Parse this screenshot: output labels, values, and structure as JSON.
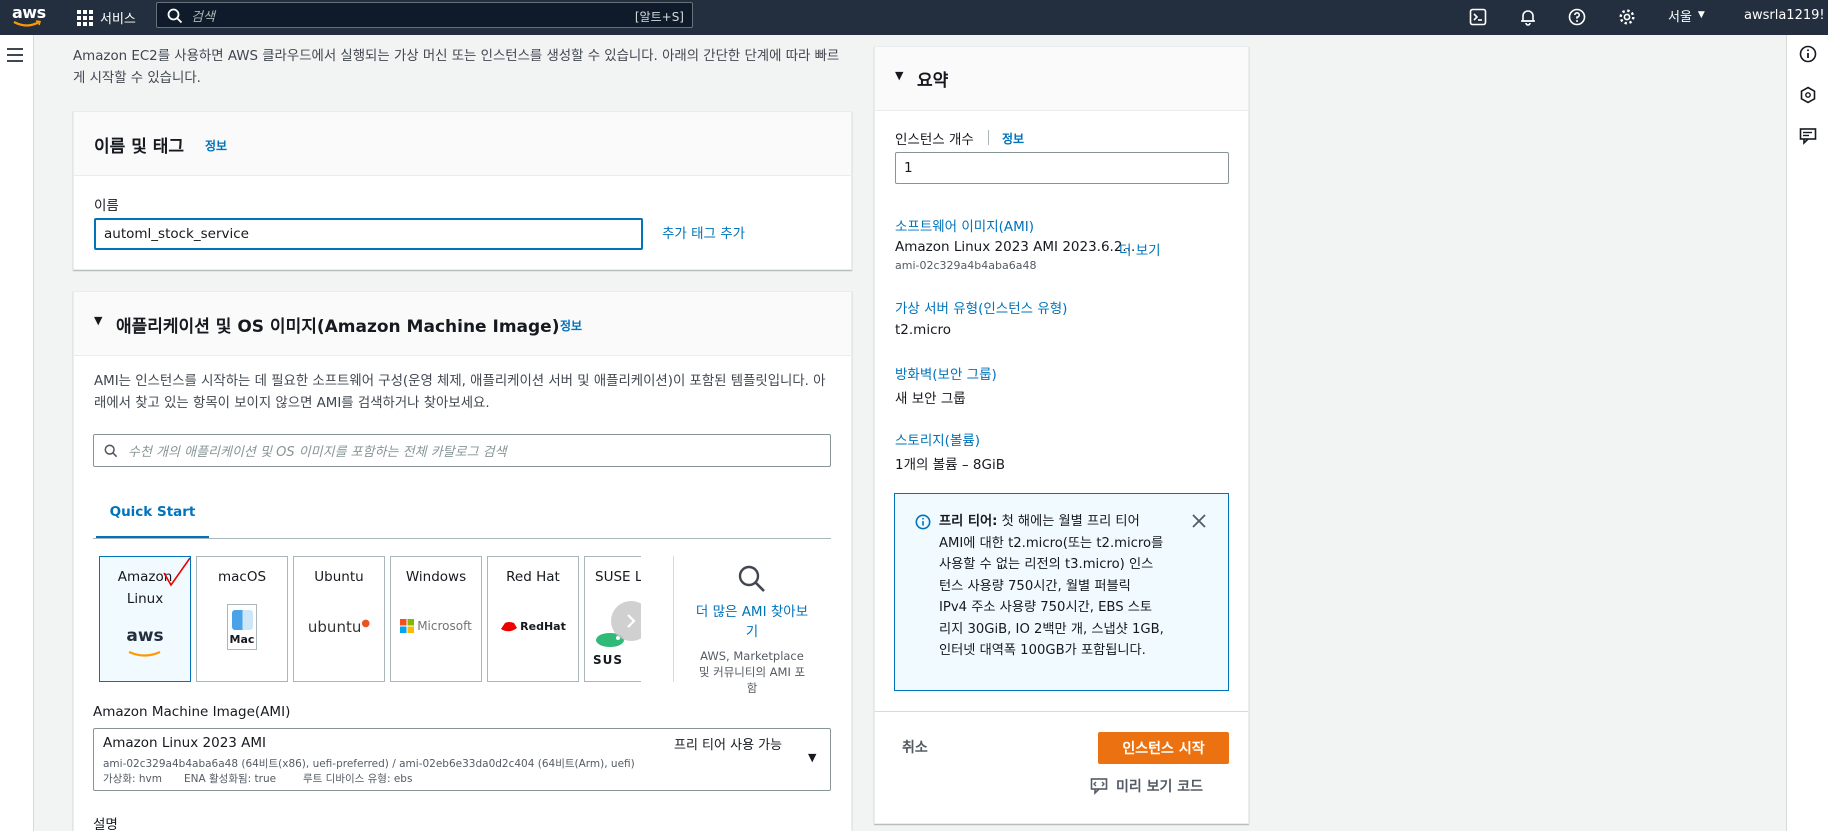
{
  "topnav": {
    "logo_text": "aws",
    "services_label": "서비스",
    "search_placeholder": "검색",
    "search_shortcut": "[알트+S]",
    "region": "서울",
    "user": "awsrla1219!"
  },
  "intro_text": "Amazon EC2를 사용하면 AWS 클라우드에서 실행되는 가상 머신 또는 인스턴스를 생성할 수 있습니다. 아래의 간단한 단계에 따라 빠르게 시작할 수 있습니다.",
  "name_tags": {
    "title": "이름 및 태그",
    "info": "정보",
    "name_label": "이름",
    "name_value": "automl_stock_service",
    "add_tag": "추가 태그 추가"
  },
  "ami_section": {
    "title": "애플리케이션 및 OS 이미지(Amazon Machine Image)",
    "info": "정보",
    "description": "AMI는 인스턴스를 시작하는 데 필요한 소프트웨어 구성(운영 체제, 애플리케이션 서버 및 애플리케이션)이 포함된 템플릿입니다. 아래에서 찾고 있는 항목이 보이지 않으면 AMI를 검색하거나 찾아보세요.",
    "search_placeholder": "수천 개의 애플리케이션 및 OS 이미지를 포함하는 전체 카탈로그 검색",
    "tab": "Quick Start",
    "tiles": [
      {
        "name": "Amazon Linux",
        "logo": "aws"
      },
      {
        "name": "macOS",
        "logo": "Mac"
      },
      {
        "name": "Ubuntu",
        "logo": "ubuntu"
      },
      {
        "name": "Windows",
        "logo": "Microsoft"
      },
      {
        "name": "Red Hat",
        "logo": "RedHat"
      },
      {
        "name": "SUSE Li",
        "logo": "SUS"
      }
    ],
    "more_label": "더 많은 AMI 찾아보기",
    "more_sub": "AWS, Marketplace 및 커뮤니티의 AMI 포함",
    "ami_label": "Amazon Machine Image(AMI)",
    "ami_name": "Amazon Linux 2023 AMI",
    "ami_badge": "프리 티어 사용 가능",
    "ami_ids": "ami-02c329a4b4aba6a48 (64비트(x86), uefi-preferred) / ami-02eb6e33da0d2c404 (64비트(Arm), uefi)",
    "ami_meta_virt": "가상화: hvm",
    "ami_meta_ena": "ENA 활성화됨: true",
    "ami_meta_root": "루트 디바이스 유형: ebs",
    "desc_label": "설명"
  },
  "summary": {
    "title": "요약",
    "count_label": "인스턴스 개수",
    "count_info": "정보",
    "count_value": "1",
    "software_label": "소프트웨어 이미지(AMI)",
    "software_value": "Amazon Linux 2023 AMI 2023.6.2...",
    "software_more": "더 보기",
    "software_id": "ami-02c329a4b4aba6a48",
    "type_label": "가상 서버 유형(인스턴스 유형)",
    "type_value": "t2.micro",
    "firewall_label": "방화벽(보안 그룹)",
    "firewall_value": "새 보안 그룹",
    "storage_label": "스토리지(볼륨)",
    "storage_value": "1개의 볼륨 – 8GiB",
    "tier_bold": "프리 티어:",
    "tier_lines": [
      "첫 해에는 월별 프리 티어",
      "AMI에 대한 t2.micro(또는 t2.micro를",
      "사용할 수 없는 리전의 t3.micro) 인스",
      "턴스 사용량 750시간, 월별 퍼블릭",
      "IPv4 주소 사용량 750시간, EBS 스토",
      "리지 30GiB, IO 2백만 개, 스냅샷 1GB,",
      "인터넷 대역폭 100GB가 포함됩니다."
    ],
    "cancel": "취소",
    "launch": "인스턴스 시작",
    "preview": "미리 보기 코드"
  }
}
